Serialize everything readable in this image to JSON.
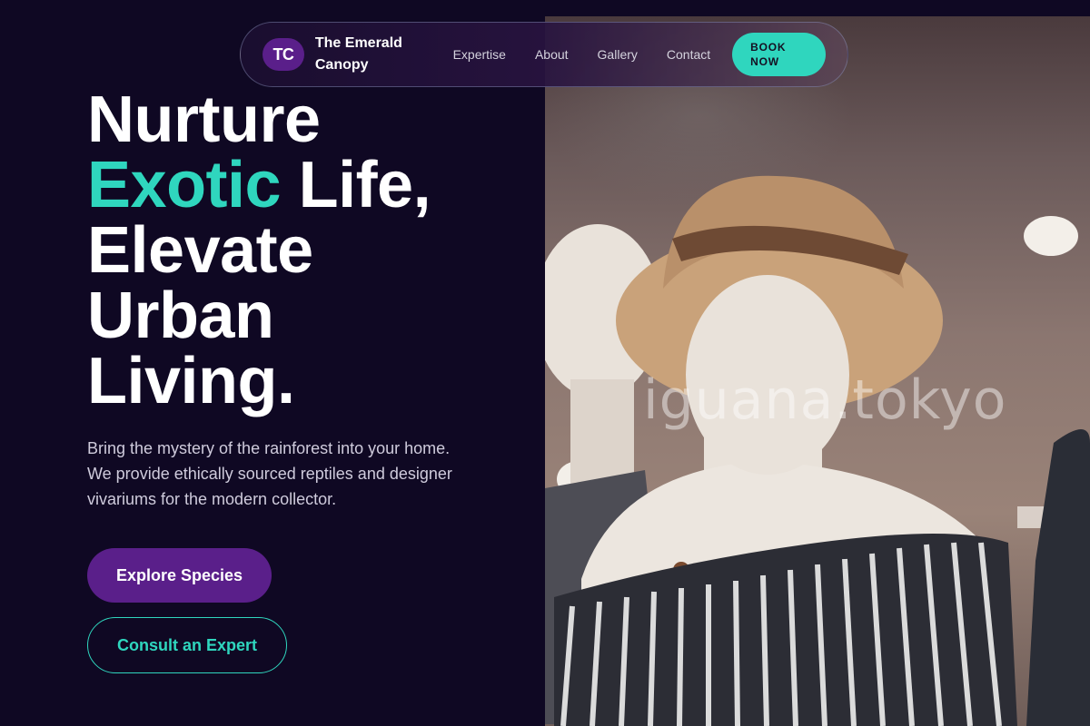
{
  "brand": {
    "initials": "TC",
    "name": "The Emerald Canopy"
  },
  "nav": {
    "links": [
      "Expertise",
      "About",
      "Gallery",
      "Contact"
    ],
    "cta_label": "BOOK NOW"
  },
  "hero": {
    "headline": {
      "line1": "Nurture",
      "accent_word": "Exotic",
      "line2_rest": "Life,",
      "line3": "Elevate",
      "line4": "Urban",
      "line5": "Living."
    },
    "subcopy": "Bring the mystery of the rainforest into your home. We provide ethically sourced reptiles and designer vivariums for the modern collector.",
    "primary_cta": "Explore Species",
    "secondary_cta": "Consult an Expert",
    "image_watermark": "iguana.tokyo"
  },
  "colors": {
    "background": "#0f0823",
    "accent_teal": "#2fd6be",
    "brand_purple": "#5a1f8a"
  }
}
